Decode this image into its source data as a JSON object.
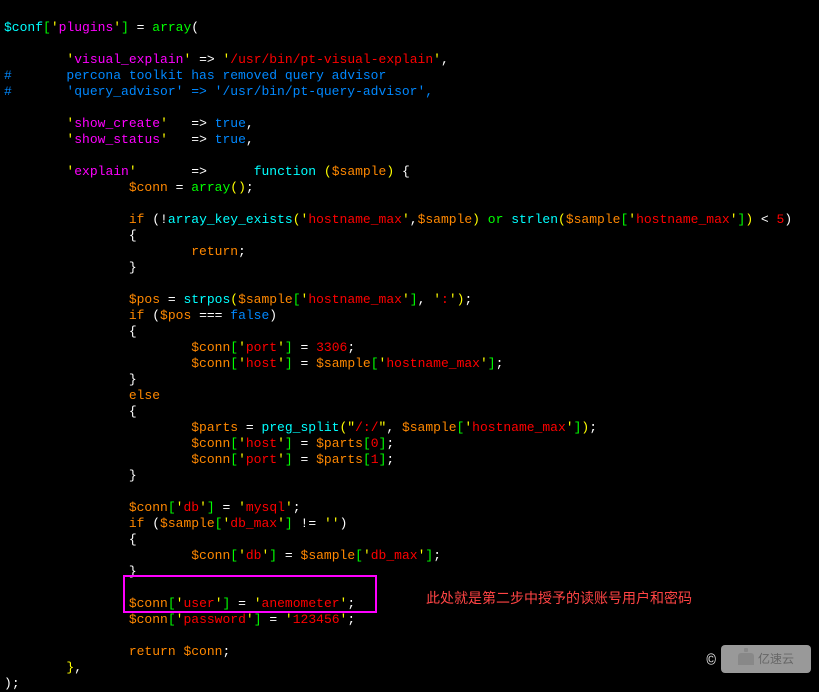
{
  "code": {
    "l1": {
      "conf": "$conf",
      "ob": "[",
      "q1": "'",
      "plugins": "plugins",
      "q2": "'",
      "cb": "]",
      "eq": " = ",
      "array": "array",
      "op": "("
    },
    "l2": {
      "indent": "        ",
      "q1": "'",
      "visual": "visual_explain",
      "q2": "'",
      "arrow": " => ",
      "q3": "'",
      "path": "/usr/bin/pt-visual-explain",
      "q4": "'",
      "comma": ","
    },
    "l3": {
      "hash": "#       ",
      "text": "percona toolkit has removed query advisor"
    },
    "l4": {
      "hash": "#       ",
      "text": "'query_advisor' => '/usr/bin/pt-query-advisor',"
    },
    "l5": "",
    "l6": {
      "indent": "        ",
      "q1": "'",
      "show": "show_create",
      "q2": "'",
      "sp": "   ",
      "arrow": "=> ",
      "true": "true",
      "comma": ","
    },
    "l7": {
      "indent": "        ",
      "q1": "'",
      "show": "show_status",
      "q2": "'",
      "sp": "   ",
      "arrow": "=> ",
      "true": "true",
      "comma": ","
    },
    "l8": "",
    "l9": {
      "indent": "        ",
      "q1": "'",
      "explain": "explain",
      "q2": "'",
      "sp": "       ",
      "arrow": "=>      ",
      "func": "function ",
      "op": "(",
      "sample": "$sample",
      "cp": ")",
      "sp2": " ",
      "brace": "{"
    },
    "l10": {
      "indent": "                ",
      "conn": "$conn",
      "eq": " = ",
      "array": "array",
      "paren": "()",
      "semi": ";"
    },
    "l11": "",
    "l12": {
      "indent": "                ",
      "if": "if ",
      "op": "(",
      "not": "!",
      "ake": "array_key_exists",
      "op2": "(",
      "q1": "'",
      "hn": "hostname_max",
      "q2": "'",
      "comma": ",",
      "sample": "$sample",
      "cp": ")",
      "or": " or ",
      "strlen": "strlen",
      "op3": "(",
      "sample2": "$sample",
      "ob": "[",
      "q3": "'",
      "hn2": "hostname_max",
      "q4": "'",
      "cb": "]",
      "cp2": ")",
      "lt": " < ",
      "five": "5",
      "cp3": ")"
    },
    "l13": {
      "indent": "                ",
      "brace": "{"
    },
    "l14": {
      "indent": "                        ",
      "return": "return",
      "semi": ";"
    },
    "l15": {
      "indent": "                ",
      "brace": "}"
    },
    "l16": "",
    "l17": {
      "indent": "                ",
      "pos": "$pos",
      "eq": " = ",
      "strpos": "strpos",
      "op": "(",
      "sample": "$sample",
      "ob": "[",
      "q1": "'",
      "hn": "hostname_max",
      "q2": "'",
      "cb": "]",
      "comma": ",",
      "sp": " ",
      "q3": "'",
      "colon": ":",
      "q4": "'",
      "cp": ")",
      "semi": ";"
    },
    "l18": {
      "indent": "                ",
      "if": "if ",
      "op": "(",
      "pos": "$pos",
      "eqeq": " === ",
      "false": "false",
      "cp": ")"
    },
    "l19": {
      "indent": "                ",
      "brace": "{"
    },
    "l20": {
      "indent": "                        ",
      "conn": "$conn",
      "ob": "[",
      "q1": "'",
      "port": "port",
      "q2": "'",
      "cb": "]",
      "eq": " = ",
      "num": "3306",
      "semi": ";"
    },
    "l21": {
      "indent": "                        ",
      "conn": "$conn",
      "ob": "[",
      "q1": "'",
      "host": "host",
      "q2": "'",
      "cb": "]",
      "eq": " = ",
      "sample": "$sample",
      "ob2": "[",
      "q3": "'",
      "hn": "hostname_max",
      "q4": "'",
      "cb2": "]",
      "semi": ";"
    },
    "l22": {
      "indent": "                ",
      "brace": "}"
    },
    "l23": {
      "indent": "                ",
      "else": "else"
    },
    "l24": {
      "indent": "                ",
      "brace": "{"
    },
    "l25": {
      "indent": "                        ",
      "parts": "$parts",
      "eq": " = ",
      "pregsplit": "preg_split",
      "op": "(",
      "q1": "\"",
      "regex": "/:/",
      "q2": "\"",
      "comma": ",",
      "sp": " ",
      "sample": "$sample",
      "ob": "[",
      "q3": "'",
      "hn": "hostname_max",
      "q4": "'",
      "cb": "]",
      "cp": ")",
      "semi": ";"
    },
    "l26": {
      "indent": "                        ",
      "conn": "$conn",
      "ob": "[",
      "q1": "'",
      "host": "host",
      "q2": "'",
      "cb": "]",
      "eq": " = ",
      "parts": "$parts",
      "ob2": "[",
      "zero": "0",
      "cb2": "]",
      "semi": ";"
    },
    "l27": {
      "indent": "                        ",
      "conn": "$conn",
      "ob": "[",
      "q1": "'",
      "port": "port",
      "q2": "'",
      "cb": "]",
      "eq": " = ",
      "parts": "$parts",
      "ob2": "[",
      "one": "1",
      "cb2": "]",
      "semi": ";"
    },
    "l28": {
      "indent": "                ",
      "brace": "}"
    },
    "l29": "",
    "l30": {
      "indent": "                ",
      "conn": "$conn",
      "ob": "[",
      "q1": "'",
      "db": "db",
      "q2": "'",
      "cb": "]",
      "eq": " = ",
      "q3": "'",
      "mysql": "mysql",
      "q4": "'",
      "semi": ";"
    },
    "l31": {
      "indent": "                ",
      "if": "if ",
      "op": "(",
      "sample": "$sample",
      "ob": "[",
      "q1": "'",
      "dbmax": "db_max",
      "q2": "'",
      "cb": "]",
      "neq": " != ",
      "q3": "'",
      "q4": "'",
      "cp": ")"
    },
    "l32": {
      "indent": "                ",
      "brace": "{"
    },
    "l33": {
      "indent": "                        ",
      "conn": "$conn",
      "ob": "[",
      "q1": "'",
      "db": "db",
      "q2": "'",
      "cb": "]",
      "eq": " = ",
      "sample": "$sample",
      "ob2": "[",
      "q3": "'",
      "dbmax": "db_max",
      "q4": "'",
      "cb2": "]",
      "semi": ";"
    },
    "l34": {
      "indent": "                ",
      "brace": "}"
    },
    "l35": "",
    "l36": {
      "indent": "                ",
      "conn": "$conn",
      "ob": "[",
      "q1": "'",
      "user": "user",
      "q2": "'",
      "cb": "]",
      "eq": " = ",
      "q3": "'",
      "anem": "anemometer",
      "q4": "'",
      "semi": ";"
    },
    "l37": {
      "indent": "                ",
      "conn": "$conn",
      "ob": "[",
      "q1": "'",
      "pwd": "password",
      "q2": "'",
      "cb": "]",
      "eq": " = ",
      "q3": "'",
      "pw": "123456",
      "q4": "'",
      "semi": ";"
    },
    "l38": "",
    "l39": {
      "indent": "                ",
      "return": "return ",
      "conn": "$conn",
      "semi": ";"
    },
    "l40": {
      "indent": "        ",
      "brace": "}",
      "comma": ","
    },
    "l41": {
      "cp": ")",
      "semi": ";"
    }
  },
  "annotation": "此处就是第二步中授予的读账号用户和密码",
  "watermark": "亿速云",
  "copyright": "©"
}
